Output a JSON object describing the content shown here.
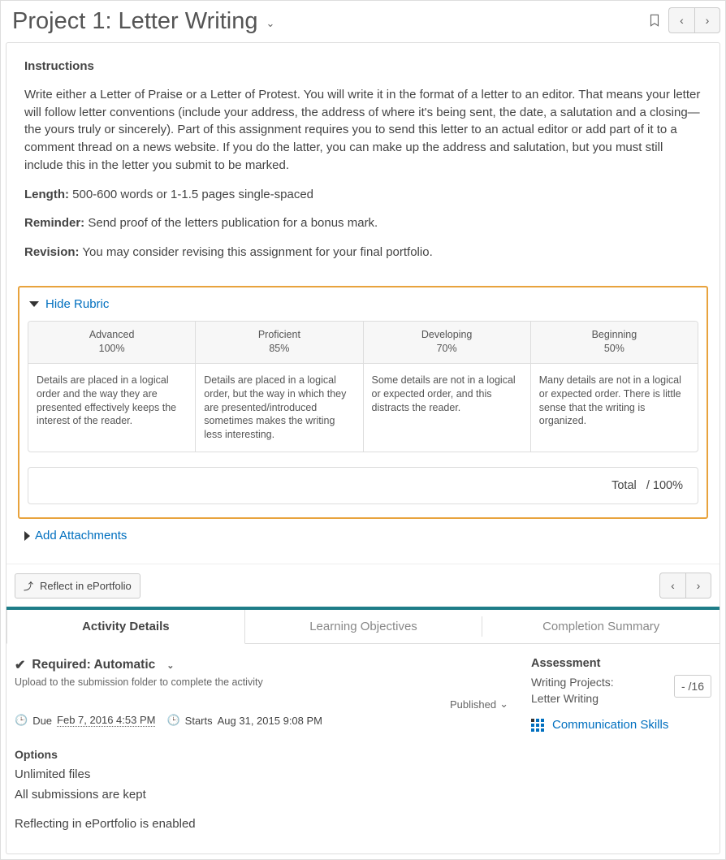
{
  "page_title": "Project 1: Letter Writing",
  "instructions": {
    "heading": "Instructions",
    "body": "Write either a Letter of Praise or a Letter of Protest. You will write it in the format of a letter to an editor. That means your letter will follow letter conventions (include your address, the address of where it's being sent, the date, a salutation and a closing—the yours truly or sincerely). Part of this assignment requires you to send this letter to an actual editor or add part of it to a comment thread on a news website. If you do the latter, you can make up the address and salutation, but you must still include this in the letter you submit to be marked.",
    "length_label": "Length:",
    "length_text": " 500-600 words or 1-1.5 pages single-spaced",
    "reminder_label": "Reminder:",
    "reminder_text": " Send proof of the letters publication for a bonus mark.",
    "revision_label": "Revision:",
    "revision_text": " You may consider revising this assignment for your final portfolio."
  },
  "rubric": {
    "toggle_label": "Hide Rubric",
    "levels": [
      {
        "name": "Advanced",
        "pct": "100%",
        "desc": "Details are placed in a logical order and  the way they are presented effectively  keeps the interest of the reader."
      },
      {
        "name": "Proficient",
        "pct": "85%",
        "desc": "Details are placed in a logical order, but the way in which they are presented/introduced sometimes makes the writing less interesting."
      },
      {
        "name": "Developing",
        "pct": "70%",
        "desc": "Some details are not in a logical or expected order, and this distracts the reader."
      },
      {
        "name": "Beginning",
        "pct": "50%",
        "desc": "Many details are not in a logical or expected order. There is little sense that the writing is organized."
      }
    ],
    "total_label": "Total",
    "total_value": "/ 100%"
  },
  "attachments_label": "Add Attachments",
  "reflect_label": "Reflect in ePortfolio",
  "tabs": {
    "activity": "Activity Details",
    "objectives": "Learning Objectives",
    "completion": "Completion Summary"
  },
  "activity": {
    "required_label": "Required: Automatic",
    "upload_hint": "Upload to the submission folder to complete the activity",
    "published_label": "Published",
    "due_label": "Due ",
    "due_date": "Feb 7, 2016 4:53 PM",
    "starts_label": "Starts ",
    "starts_date": "Aug 31, 2015 9:08 PM",
    "options_heading": "Options",
    "options": [
      "Unlimited files",
      "All submissions are kept"
    ],
    "reflect_line": "Reflecting in ePortfolio is enabled"
  },
  "assessment": {
    "heading": "Assessment",
    "item1": "Writing Projects:",
    "item2": "Letter Writing",
    "grade": "- /16",
    "comm_label": "Communication Skills"
  }
}
